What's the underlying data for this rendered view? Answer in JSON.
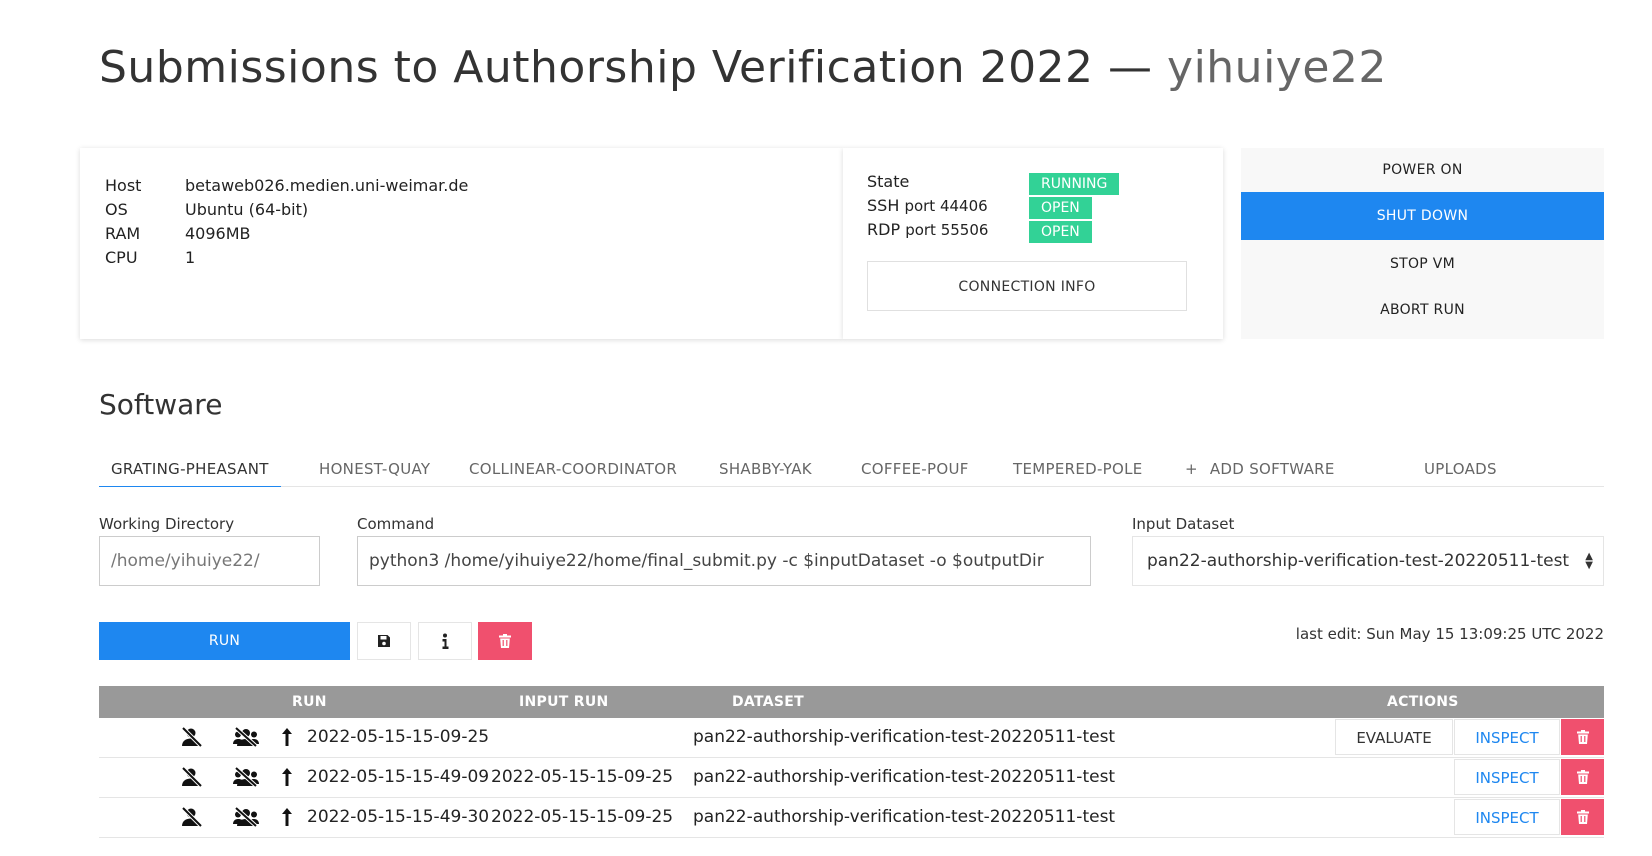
{
  "page": {
    "title_prefix": "Submissions to Authorship Verification 2022 — ",
    "user": "yihuiye22"
  },
  "vm": {
    "specs": [
      {
        "key": "Host",
        "value": "betaweb026.medien.uni-weimar.de"
      },
      {
        "key": "OS",
        "value": "Ubuntu (64-bit)"
      },
      {
        "key": "RAM",
        "value": "4096MB"
      },
      {
        "key": "CPU",
        "value": "1"
      }
    ],
    "state_label": "State",
    "state_value": "RUNNING",
    "ssh_label": "SSH",
    "ssh_port": "port 44406",
    "ssh_status": "OPEN",
    "rdp_label": "RDP",
    "rdp_port": "port 55506",
    "rdp_status": "OPEN",
    "connection_info_label": "CONNECTION INFO",
    "buttons": {
      "power_on": "POWER ON",
      "shut_down": "SHUT DOWN",
      "stop_vm": "STOP VM",
      "abort_run": "ABORT RUN"
    }
  },
  "software": {
    "section_title": "Software",
    "tabs": [
      "GRATING-PHEASANT",
      "HONEST-QUAY",
      "COLLINEAR-COORDINATOR",
      "SHABBY-YAK",
      "COFFEE-POUF",
      "TEMPERED-POLE",
      "ADD SOFTWARE",
      "UPLOADS"
    ],
    "add_symbol": "+",
    "working_directory_label": "Working Directory",
    "working_directory_placeholder": "/home/yihuiye22/",
    "command_label": "Command",
    "command_value": "python3 /home/yihuiye22/home/final_submit.py -c $inputDataset -o $outputDir",
    "input_dataset_label": "Input Dataset",
    "input_dataset_value": "pan22-authorship-verification-test-20220511-test",
    "run_label": "RUN",
    "last_edit": "last edit: Sun May 15 13:09:25 UTC 2022",
    "icons": {
      "save": "save-icon",
      "info": "info-icon",
      "delete": "trash-icon"
    }
  },
  "runs": {
    "headers": {
      "run": "RUN",
      "input_run": "INPUT RUN",
      "dataset": "DATASET",
      "actions": "ACTIONS"
    },
    "evaluate_label": "EVALUATE",
    "inspect_label": "INSPECT",
    "rows": [
      {
        "run": "2022-05-15-15-09-25",
        "input_run": "",
        "dataset": "pan22-authorship-verification-test-20220511-test",
        "evaluate": true
      },
      {
        "run": "2022-05-15-15-49-09",
        "input_run": "2022-05-15-15-09-25",
        "dataset": "pan22-authorship-verification-test-20220511-test",
        "evaluate": false
      },
      {
        "run": "2022-05-15-15-49-30",
        "input_run": "2022-05-15-15-09-25",
        "dataset": "pan22-authorship-verification-test-20220511-test",
        "evaluate": false
      }
    ]
  },
  "colors": {
    "primary": "#1e87f0",
    "success": "#32d296",
    "danger": "#f0506e",
    "table_header": "#999999"
  }
}
